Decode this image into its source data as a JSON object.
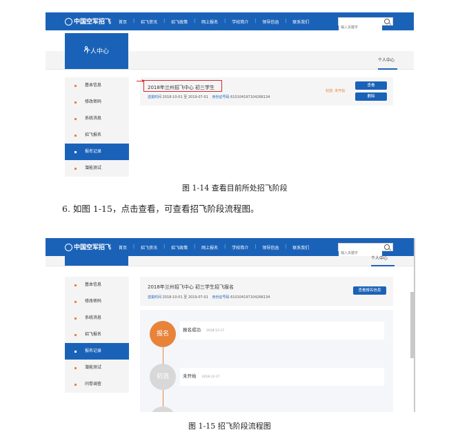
{
  "nav": {
    "logo": "中国空军招飞",
    "items": [
      "首页",
      "招飞资讯",
      "招飞政策",
      "网上报名",
      "学校简介",
      "领导信函",
      "联系我们"
    ],
    "search_placeholder": "输入关键字"
  },
  "sidebar_header": "个人中心",
  "breadcrumb_tab": "个人中心",
  "sidebar1": [
    "基本信息",
    "修改密码",
    "系统消息",
    "招飞报名",
    "报名记录",
    "潜能测试"
  ],
  "sidebar2": [
    "基本信息",
    "修改密码",
    "系统消息",
    "招飞报名",
    "报名记录",
    "潜能测试",
    "问卷调查"
  ],
  "active_item": "报名记录",
  "record": {
    "title1": "2018年兰州招飞中心 初三学生",
    "title2": "2018年兰州招飞中心 初三学生招飞报名",
    "time_key": "选拔时间",
    "time_val": "2018-10-01 至 2019-07-01",
    "id_key": "身份证号码",
    "id_val": "610104197104266134",
    "status": "初选: 未开始",
    "view_btn": "查看",
    "delete_btn": "删除",
    "view_info_btn": "查看报名信息"
  },
  "steps": [
    {
      "circle": "报名",
      "label": "报名成功",
      "date": "2018-12-17"
    },
    {
      "circle": "初选",
      "label": "未开始",
      "date": "2018-12-17"
    }
  ],
  "caption1": "图 1-14  查看目前所处招飞阶段",
  "paragraph": "6.  如图 1-15，点击查看，可查看招飞阶段流程图。",
  "caption2": "图 1-15  招飞阶段流程图"
}
